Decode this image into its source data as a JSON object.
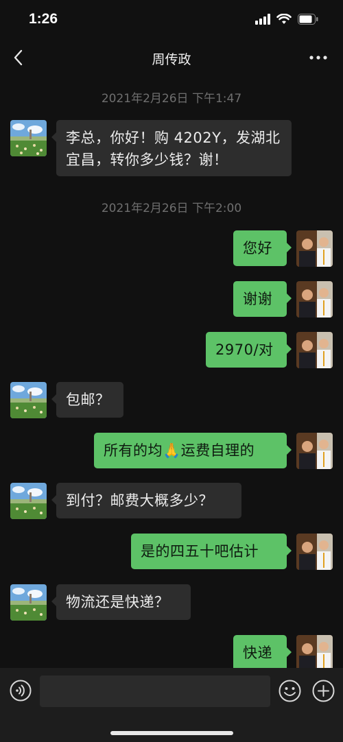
{
  "status": {
    "time": "1:26"
  },
  "nav": {
    "title": "周传政"
  },
  "chat": {
    "timestamps": [
      "2021年2月26日 下午1:47",
      "2021年2月26日 下午2:00"
    ],
    "messages": [
      {
        "side": "left",
        "text": "李总，你好！购 4202Y，发湖北宜昌，转你多少钱？谢！"
      },
      {
        "side": "right",
        "text": "您好"
      },
      {
        "side": "right",
        "text": "谢谢"
      },
      {
        "side": "right",
        "text": "2970/对"
      },
      {
        "side": "left",
        "text": "包邮？"
      },
      {
        "side": "right",
        "text": "所有的均🙏运费自理的"
      },
      {
        "side": "left",
        "text": "到付？邮费大概多少？"
      },
      {
        "side": "right",
        "text": "是的四五十吧估计"
      },
      {
        "side": "left",
        "text": "物流还是快递？"
      },
      {
        "side": "right",
        "text": "快递"
      }
    ]
  },
  "input": {
    "placeholder": ""
  },
  "colors": {
    "background": "#111111",
    "outgoing_bubble": "#5dc267",
    "incoming_bubble": "#2d2d2d",
    "timestamp": "#6f6f6f"
  },
  "icons": {
    "back": "chevron-left-icon",
    "more": "ellipsis-icon",
    "voice": "voice-icon",
    "emoji": "smiley-icon",
    "plus": "plus-icon"
  }
}
